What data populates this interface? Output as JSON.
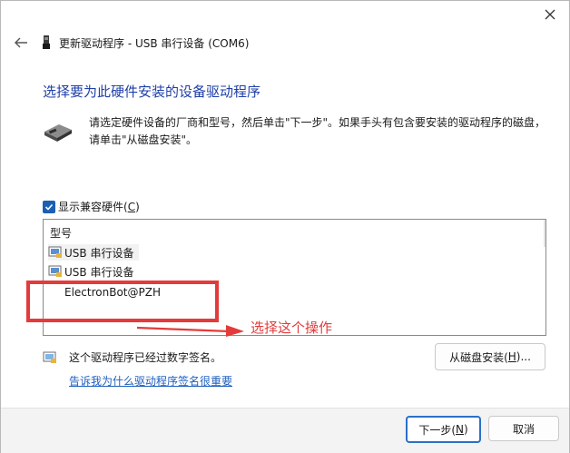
{
  "dialog": {
    "title": "更新驱动程序 - USB 串行设备 (COM6)",
    "heading": "选择要为此硬件安装的设备驱动程序",
    "description": "请选定硬件设备的厂商和型号，然后单击\"下一步\"。如果手头有包含要安装的驱动程序的磁盘，请单击\"从磁盘安装\"。",
    "show_compatible_checkbox": {
      "label": "显示兼容硬件(",
      "accel": "C",
      "label_end": ")",
      "checked": true
    },
    "list": {
      "header": "型号",
      "items": [
        {
          "label": "USB 串行设备",
          "icon": "driver-icon"
        },
        {
          "label": "USB 串行设备",
          "icon": "driver-icon"
        },
        {
          "label": "ElectronBot@PZH",
          "icon": ""
        }
      ]
    },
    "signature": {
      "text": "这个驱动程序已经过数字签名。",
      "link": "告诉我为什么驱动程序签名很重要"
    },
    "buttons": {
      "have_disk": {
        "label": "从磁盘安装(",
        "accel": "H",
        "label_end": ")..."
      },
      "next": {
        "label": "下一步(",
        "accel": "N",
        "label_end": ")"
      },
      "cancel": "取消"
    }
  },
  "annotation": {
    "text": "选择这个操作",
    "color": "#e33b3b"
  },
  "colors": {
    "heading": "#1f3fa8",
    "link": "#1f5fbf",
    "checkbox": "#1a5fb4",
    "primary_border": "#2b6fc7"
  }
}
